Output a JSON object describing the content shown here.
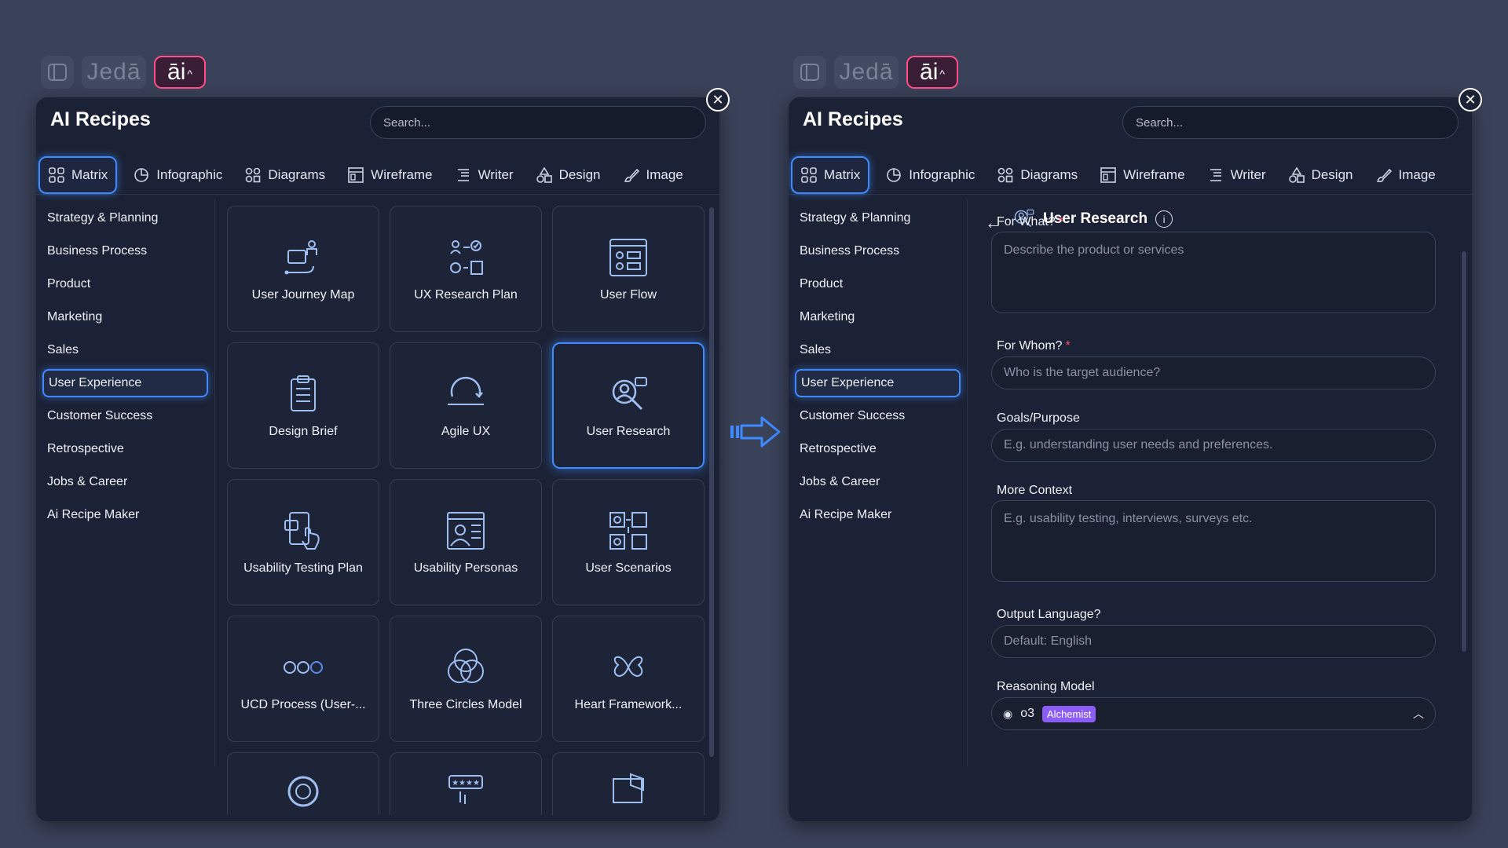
{
  "topbar": {
    "brand": "Jedā",
    "ai_label": "āi",
    "ai_chevron": "^"
  },
  "panel": {
    "title": "AI Recipes",
    "search_placeholder": "Search...",
    "close": "✕"
  },
  "tabs": [
    {
      "label": "Matrix",
      "icon": "matrix-icon"
    },
    {
      "label": "Infographic",
      "icon": "pie-icon"
    },
    {
      "label": "Diagrams",
      "icon": "diagram-icon"
    },
    {
      "label": "Wireframe",
      "icon": "wireframe-icon"
    },
    {
      "label": "Writer",
      "icon": "writer-icon"
    },
    {
      "label": "Design",
      "icon": "shapes-icon"
    },
    {
      "label": "Image",
      "icon": "brush-icon"
    }
  ],
  "sidebar": [
    "Strategy & Planning",
    "Business Process",
    "Product",
    "Marketing",
    "Sales",
    "User Experience",
    "Customer Success",
    "Retrospective",
    "Jobs & Career",
    "Ai Recipe Maker"
  ],
  "cards": [
    {
      "label": "User Journey Map",
      "icon": "journey-map-icon"
    },
    {
      "label": "UX Research Plan",
      "icon": "research-plan-icon"
    },
    {
      "label": "User Flow",
      "icon": "user-flow-icon"
    },
    {
      "label": "Design Brief",
      "icon": "clipboard-icon"
    },
    {
      "label": "Agile UX",
      "icon": "agile-cycle-icon"
    },
    {
      "label": "User Research",
      "icon": "user-research-icon"
    },
    {
      "label": "Usability Testing Plan",
      "icon": "usability-test-icon"
    },
    {
      "label": "Usability Personas",
      "icon": "persona-icon"
    },
    {
      "label": "User Scenarios",
      "icon": "scenarios-icon"
    },
    {
      "label": "UCD Process (User-...",
      "icon": "ucd-circles-icon"
    },
    {
      "label": "Three Circles Model",
      "icon": "three-circles-icon"
    },
    {
      "label": "Heart Framework...",
      "icon": "heart-framework-icon"
    }
  ],
  "form": {
    "title": "User Research",
    "back": "←",
    "info": "i",
    "for_what_label": "For What?",
    "for_what_placeholder": "Describe the product or services",
    "for_whom_label": "For Whom?",
    "for_whom_placeholder": "Who is the target audience?",
    "goals_label": "Goals/Purpose",
    "goals_placeholder": "E.g. understanding user needs and preferences.",
    "context_label": "More Context",
    "context_placeholder": "E.g. usability testing, interviews, surveys etc.",
    "language_label": "Output Language?",
    "language_placeholder": "Default: English",
    "model_label": "Reasoning Model",
    "model_value": "o3",
    "model_badge": "Alchemist",
    "required_mark": "*"
  },
  "colors": {
    "accent": "#3d8bff",
    "ai_pink": "#ff4d8a",
    "badge": "#8b5cf6",
    "required": "#ff4d6a"
  }
}
